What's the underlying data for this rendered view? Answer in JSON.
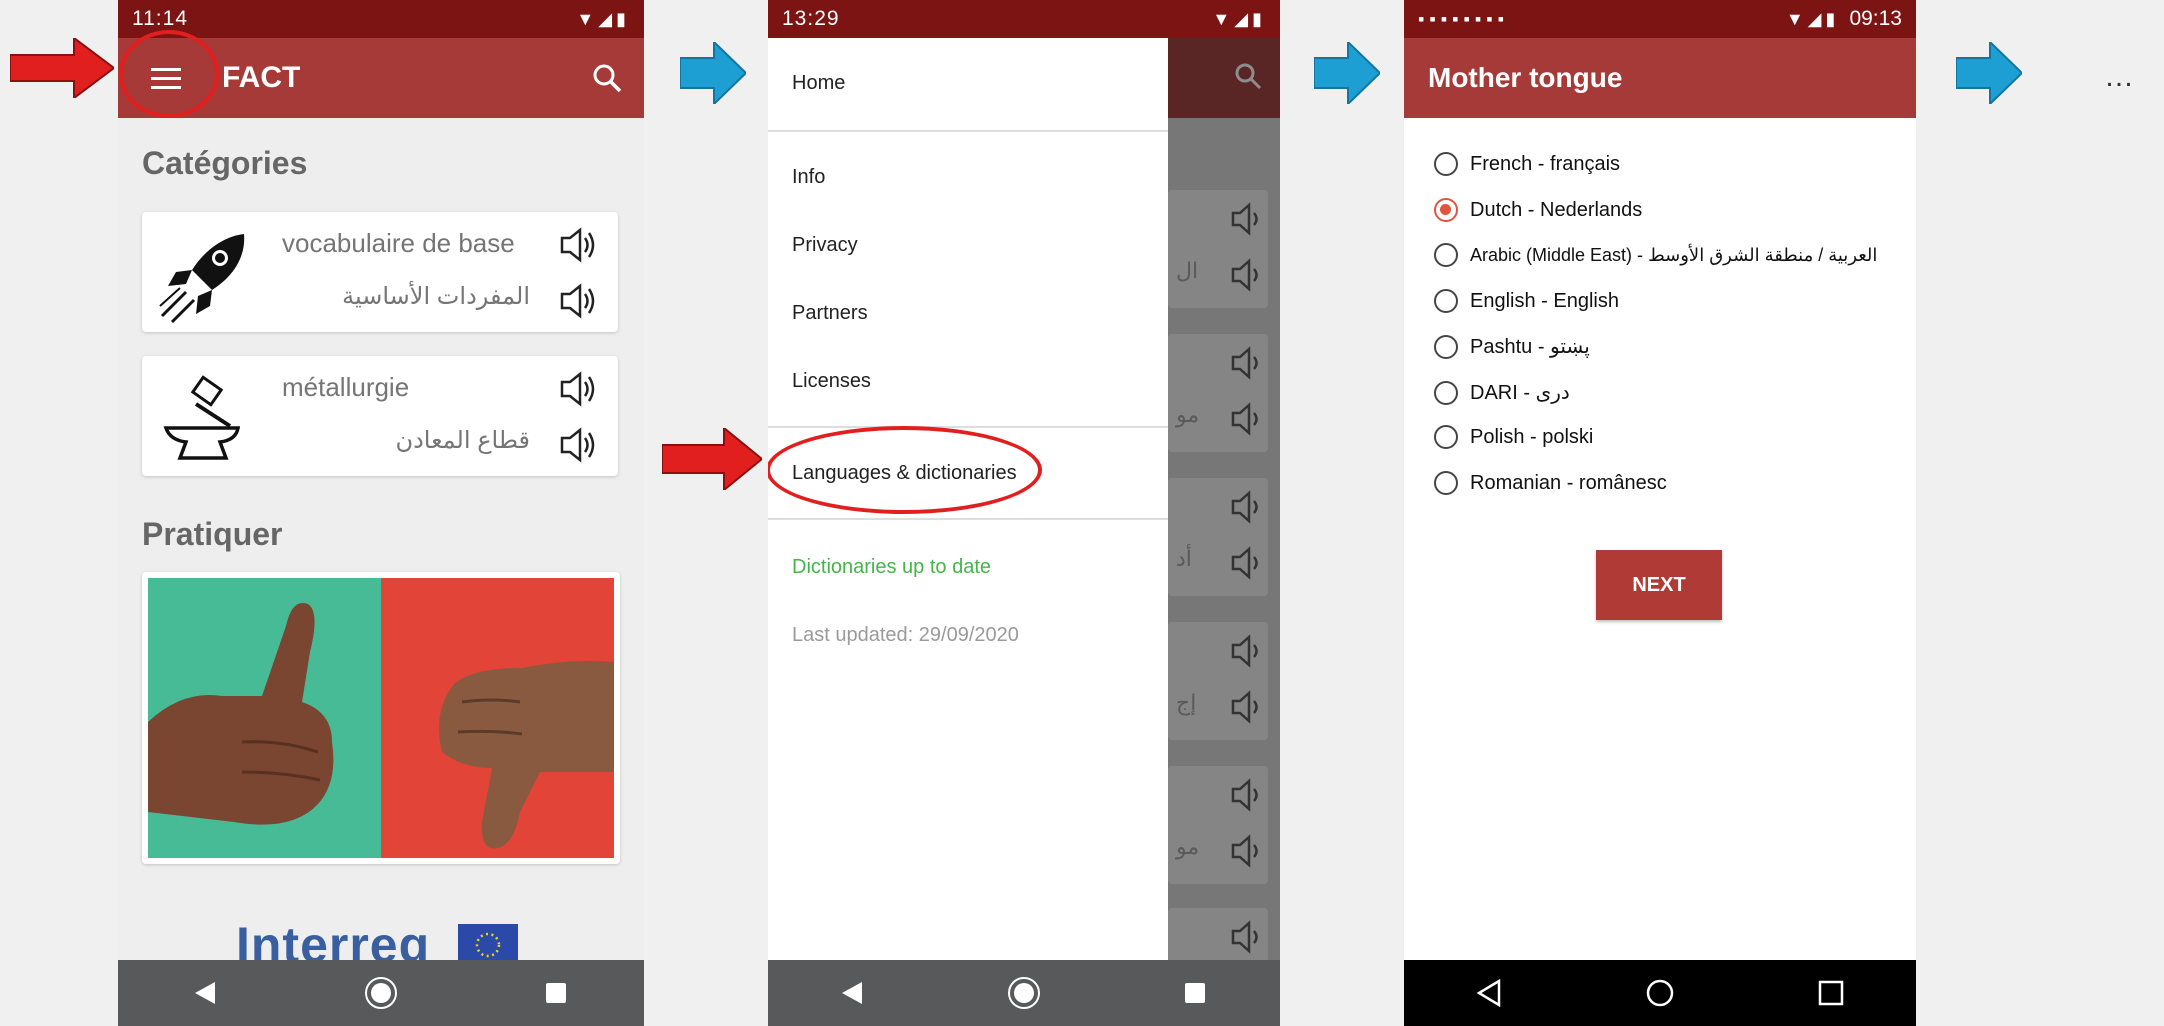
{
  "colors": {
    "status_bar": "#7d1414",
    "app_bar": "#a63a38",
    "red_arrow": "#e21f1f",
    "blue_arrow": "#1e9fd4",
    "green_text": "#43b649",
    "radio_checked": "#e0533f"
  },
  "screen1": {
    "status_time": "11:14",
    "app_title": "FACT",
    "categories_heading": "Catégories",
    "categories": [
      {
        "title": "vocabulaire de base",
        "translation": "المفردات الأساسية",
        "icon": "rocket-icon"
      },
      {
        "title": "métallurgie",
        "translation": "قطاع المعادن",
        "icon": "hammer-anvil-icon"
      }
    ],
    "practice_heading": "Pratiquer",
    "footer_logo_text": "Interreg"
  },
  "screen2": {
    "status_time": "13:29",
    "drawer_items": {
      "home": "Home",
      "info": "Info",
      "privacy": "Privacy",
      "partners": "Partners",
      "licenses": "Licenses",
      "languages": "Languages & dictionaries"
    },
    "sync_status": "Dictionaries up to date",
    "last_updated": "Last updated: 29/09/2020",
    "behind_snippets": [
      "ال",
      "مو",
      "أد",
      "إج",
      "مو"
    ]
  },
  "screen3": {
    "status_time": "09:13",
    "title": "Mother tongue",
    "languages": [
      {
        "label": "French - français",
        "selected": false
      },
      {
        "label": "Dutch - Nederlands",
        "selected": true
      },
      {
        "label": "Arabic (Middle East) - العربية / منطقة الشرق الأوسط",
        "selected": false
      },
      {
        "label": "English - English",
        "selected": false
      },
      {
        "label": "Pashtu - پښتو",
        "selected": false
      },
      {
        "label": "DARI - دری",
        "selected": false
      },
      {
        "label": "Polish - polski",
        "selected": false
      },
      {
        "label": "Romanian - românesc",
        "selected": false
      }
    ],
    "next_label": "NEXT"
  },
  "ellipsis": "…"
}
